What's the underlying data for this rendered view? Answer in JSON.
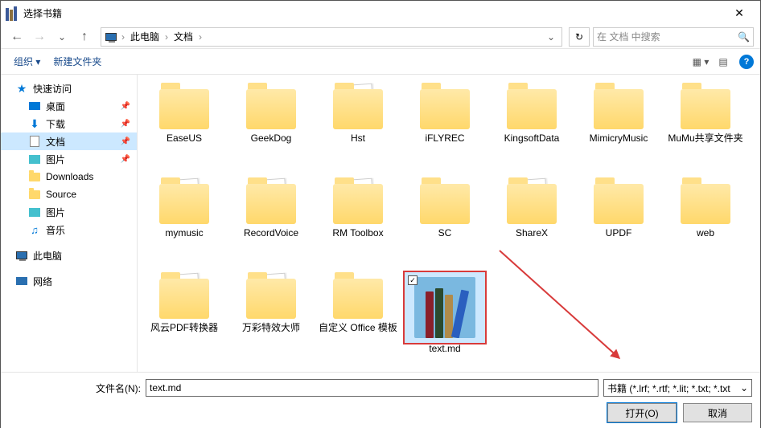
{
  "titlebar": {
    "title": "选择书籍",
    "close": "✕"
  },
  "nav": {
    "back": "←",
    "forward": "→",
    "recent_drop": "⌄",
    "up": "↑",
    "crumbs": [
      "此电脑",
      "文档"
    ],
    "sep": "›",
    "refresh": "↻",
    "search_placeholder": "在 文档 中搜索",
    "search_icon": "🔍",
    "breadcrumb_dropdown": "⌄"
  },
  "toolbar": {
    "organize": "组织 ▾",
    "new_folder": "新建文件夹",
    "view_icon": "▦ ▾",
    "detail_icon": "▤",
    "help": "?"
  },
  "sidebar": {
    "quick": {
      "label": "快速访问",
      "items": [
        {
          "label": "桌面",
          "type": "desk",
          "pin": true
        },
        {
          "label": "下载",
          "type": "down",
          "pin": true
        },
        {
          "label": "文档",
          "type": "doc",
          "pin": true,
          "selected": true
        },
        {
          "label": "图片",
          "type": "pic",
          "pin": true
        },
        {
          "label": "Downloads",
          "type": "folder"
        },
        {
          "label": "Source",
          "type": "folder"
        },
        {
          "label": "图片",
          "type": "pic"
        },
        {
          "label": "音乐",
          "type": "music"
        }
      ]
    },
    "pc": {
      "label": "此电脑"
    },
    "net": {
      "label": "网络"
    }
  },
  "content": {
    "items": [
      {
        "label": "EaseUS",
        "type": "folder"
      },
      {
        "label": "GeekDog",
        "type": "folder"
      },
      {
        "label": "Hst",
        "type": "folder-docs"
      },
      {
        "label": "iFLYREC",
        "type": "folder"
      },
      {
        "label": "KingsoftData",
        "type": "folder"
      },
      {
        "label": "MimicryMusic",
        "type": "folder"
      },
      {
        "label": "MuMu共享文件夹",
        "type": "folder"
      },
      {
        "label": "mymusic",
        "type": "folder-docs"
      },
      {
        "label": "RecordVoice",
        "type": "folder-docs"
      },
      {
        "label": "RM Toolbox",
        "type": "folder-docs"
      },
      {
        "label": "SC",
        "type": "folder"
      },
      {
        "label": "ShareX",
        "type": "folder-docs"
      },
      {
        "label": "UPDF",
        "type": "folder"
      },
      {
        "label": "web",
        "type": "folder"
      },
      {
        "label": "风云PDF转换器",
        "type": "folder-docs"
      },
      {
        "label": "万彩特效大师",
        "type": "folder-docs"
      },
      {
        "label": "自定义 Office 模板",
        "type": "folder"
      },
      {
        "label": "text.md",
        "type": "file",
        "selected": true
      }
    ]
  },
  "footer": {
    "filename_label": "文件名(N):",
    "filename_value": "text.md",
    "filter": "书籍 (*.lrf; *.rtf; *.lit; *.txt; *.txt",
    "filter_drop": "⌄",
    "open": "打开(O)",
    "cancel": "取消"
  },
  "glyphs": {
    "pin": "📌",
    "check": "✓",
    "star": "★",
    "down_arrow": "⬇",
    "music": "♫"
  }
}
